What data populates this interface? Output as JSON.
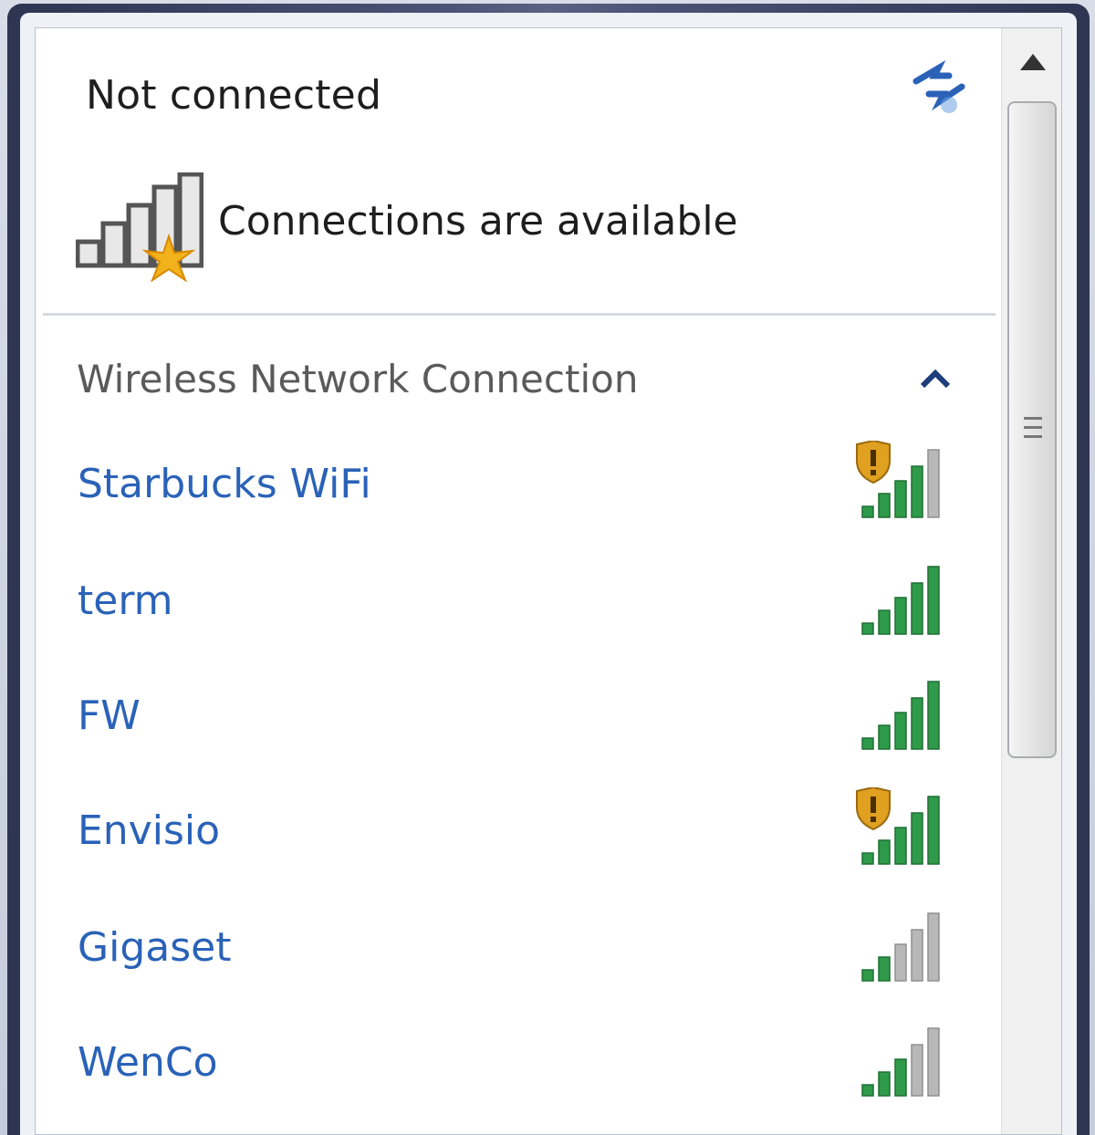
{
  "header": {
    "status_title": "Not connected",
    "availability_text": "Connections are available",
    "refresh_icon": "refresh-arrows-icon",
    "signal_icon": "signal-available-icon"
  },
  "section": {
    "title": "Wireless Network Connection",
    "toggle_icon": "chevron-up-icon"
  },
  "networks": [
    {
      "name": "Starbucks WiFi",
      "secured_warning": true,
      "signal_bars": 4,
      "signal_max": 5
    },
    {
      "name": "term",
      "secured_warning": false,
      "signal_bars": 5,
      "signal_max": 5
    },
    {
      "name": "FW",
      "secured_warning": false,
      "signal_bars": 5,
      "signal_max": 5
    },
    {
      "name": "Envisio",
      "secured_warning": true,
      "signal_bars": 5,
      "signal_max": 5
    },
    {
      "name": "Gigaset",
      "secured_warning": false,
      "signal_bars": 2,
      "signal_max": 5
    },
    {
      "name": "WenCo",
      "secured_warning": false,
      "signal_bars": 3,
      "signal_max": 5
    }
  ],
  "colors": {
    "link": "#2a62b8",
    "signal_active": "#2f9a4a",
    "signal_inactive": "#b8b8b8",
    "shield": "#e0a020"
  }
}
